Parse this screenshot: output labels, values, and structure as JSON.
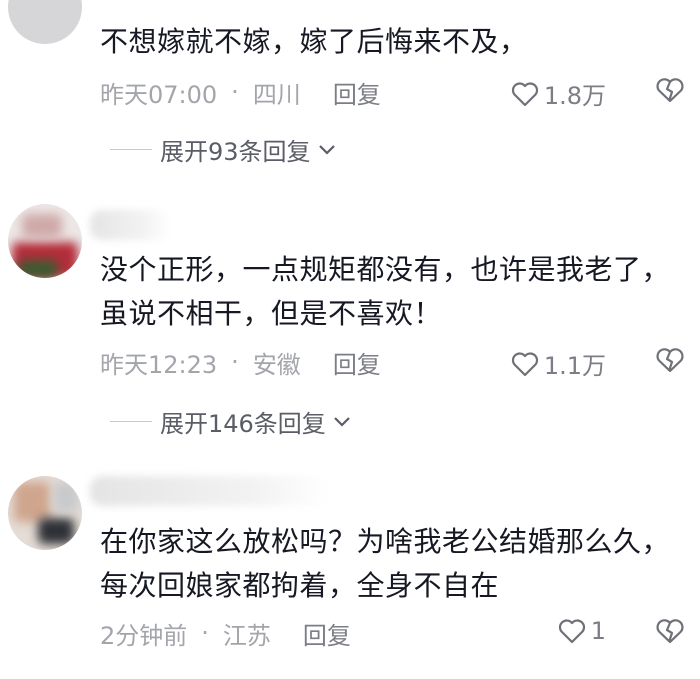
{
  "comments": [
    {
      "text": "不想嫁就不嫁，嫁了后悔来不及，",
      "time": "昨天07:00",
      "location": "四川",
      "reply_label": "回复",
      "likes": "1.8万",
      "expand_label": "展开93条回复"
    },
    {
      "text": "没个正形，一点规矩都没有，也许是我老了，虽说不相干，但是不喜欢！",
      "time": "昨天12:23",
      "location": "安徽",
      "reply_label": "回复",
      "likes": "1.1万",
      "expand_label": "展开146条回复"
    },
    {
      "text": "在你家这么放松吗？为啥我老公结婚那么久，每次回娘家都拘着，全身不自在",
      "time": "2分钟前",
      "location": "江苏",
      "reply_label": "回复",
      "likes": "1"
    }
  ],
  "meta_separator": "·",
  "icons": {
    "like": "heart-outline-icon",
    "dislike": "broken-heart-icon",
    "expand": "chevron-down-icon"
  },
  "colors": {
    "text": "#161823",
    "meta": "#a3a5ab",
    "action": "#7c7e86"
  }
}
